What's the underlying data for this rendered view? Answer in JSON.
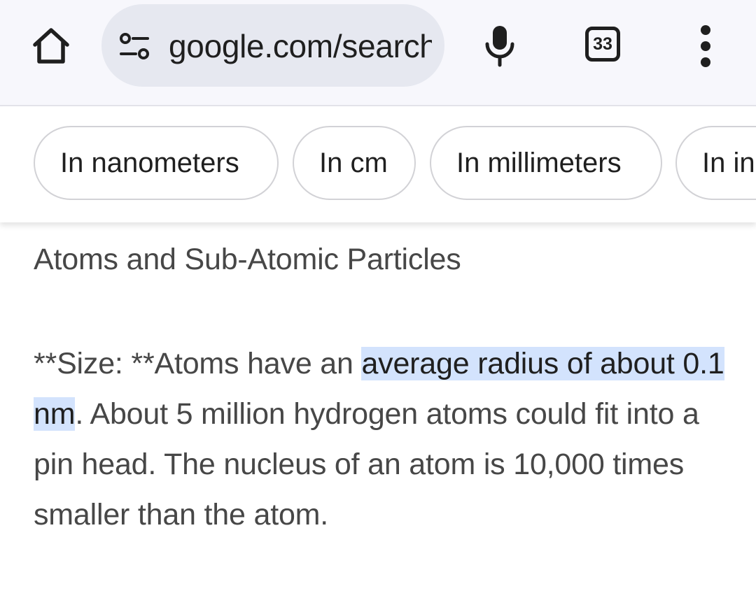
{
  "browser": {
    "url": "google.com/search",
    "tab_count": "33",
    "icons": {
      "home": "home-icon",
      "site_info": "site-info-icon",
      "mic": "mic-icon",
      "tabs": "tab-switcher-icon",
      "menu": "more-vert-icon"
    }
  },
  "chips": [
    {
      "label": "In nanometers"
    },
    {
      "label": "In cm"
    },
    {
      "label": "In millimeters"
    },
    {
      "label": "In inches"
    }
  ],
  "result": {
    "heading": "Atoms and Sub-Atomic Particles",
    "snippet_prefix": "**Size: **Atoms have an ",
    "snippet_highlight": "average radius of about 0.1 nm",
    "snippet_suffix": ". About 5 million hydrogen atoms could fit into a pin head. The nucleus of an atom is 10,000 times smaller than the atom."
  },
  "colors": {
    "highlight": "#d3e3fd",
    "toolbar_bg": "#f7f7fc",
    "url_pill_bg": "#e6e8f0",
    "text_secondary": "#474747"
  }
}
